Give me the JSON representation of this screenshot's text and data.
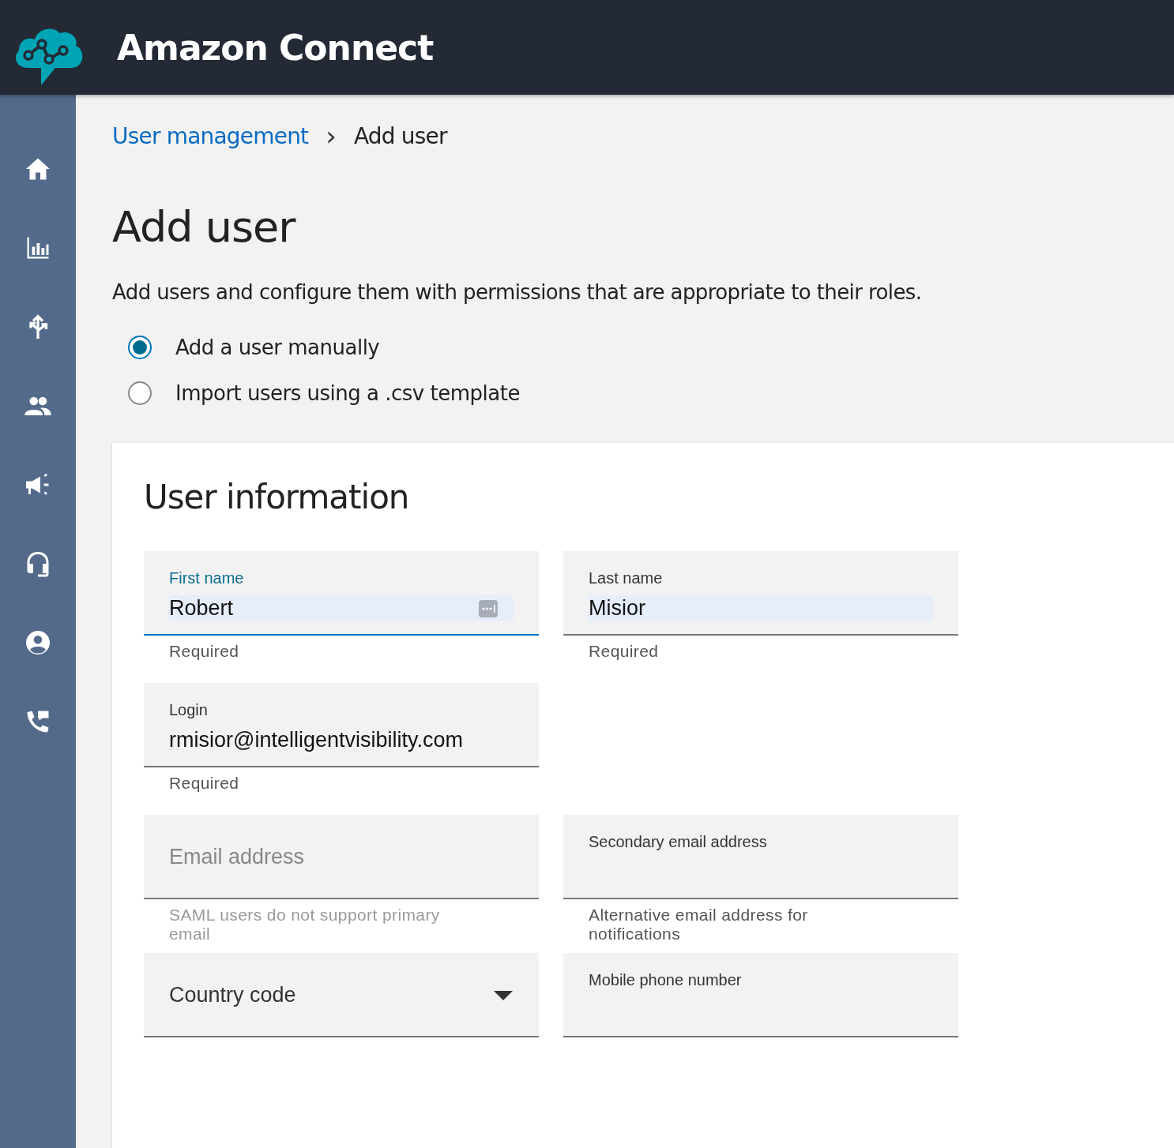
{
  "header": {
    "title": "Amazon Connect"
  },
  "breadcrumb": {
    "items": [
      {
        "label": "User management",
        "kind": "link"
      },
      {
        "label": "Add user",
        "kind": "current"
      }
    ],
    "separator": "›"
  },
  "page": {
    "title": "Add user",
    "description": "Add users and configure them with permissions that are appropriate to their roles."
  },
  "options": [
    {
      "label": "Add a user manually",
      "selected": true
    },
    {
      "label": "Import users using a .csv template",
      "selected": false
    }
  ],
  "card": {
    "title": "User information",
    "rows": [
      [
        {
          "kind": "text",
          "label": "First name",
          "value": "Robert",
          "focused": true,
          "autofilled": true,
          "key_icon": true,
          "helper": "Required"
        },
        {
          "kind": "text",
          "label": "Last name",
          "value": "Misior",
          "focused": false,
          "autofilled": true,
          "helper": "Required"
        }
      ],
      [
        {
          "kind": "text",
          "label": "Login",
          "value": "rmisior@intelligentvisibility.com",
          "focused": false,
          "autofilled": false,
          "helper": "Required"
        }
      ],
      [
        {
          "kind": "placeholder",
          "placeholder": "Email address",
          "focused": false,
          "helper": "SAML users do not support primary email",
          "helper_disabled": true
        },
        {
          "kind": "text",
          "label": "Secondary email address",
          "focused": false,
          "autofilled": false,
          "helper": "Alternative email address for notifications",
          "helper_disabled": false
        }
      ],
      [
        {
          "kind": "select",
          "placeholder": "Country code",
          "focused": false
        },
        {
          "kind": "text",
          "label": "Mobile phone number",
          "focused": false,
          "autofilled": false
        }
      ]
    ]
  }
}
